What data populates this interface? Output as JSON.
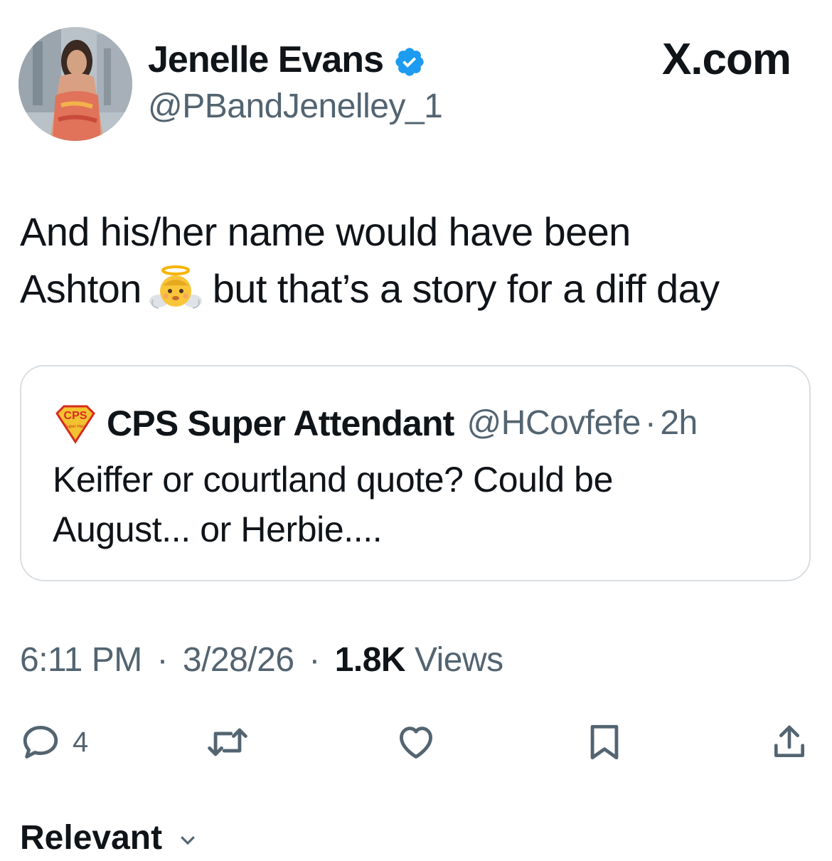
{
  "author": {
    "display_name": "Jenelle Evans",
    "handle": "@PBandJenelley_1",
    "verified_icon": "verified-badge-icon",
    "avatar": "profile-photo"
  },
  "site_mark": "X.com",
  "tweet": {
    "line1": "And his/her name would have been",
    "line2_before": "Ashton",
    "line2_emoji": "baby-angel-emoji",
    "line2_after": "but that’s a story for a diff day"
  },
  "quoted_tweet": {
    "avatar_text": "CPS",
    "avatar_subtext": "Super Hero",
    "display_name": "CPS Super Attendant",
    "handle": "@HCovfefe",
    "separator": "·",
    "time": "2h",
    "line1": "Keiffer or courtland quote? Could be",
    "line2": "August... or Herbie...."
  },
  "meta": {
    "time": "6:11 PM",
    "separator": "·",
    "date": "3/28/26",
    "views_count": "1.8K",
    "views_label": "Views"
  },
  "actions": {
    "reply_count": "4",
    "reply_icon": "reply-icon",
    "repost_icon": "repost-icon",
    "like_icon": "like-icon",
    "bookmark_icon": "bookmark-icon",
    "share_icon": "share-icon"
  },
  "footer": {
    "relevant_label": "Relevant"
  },
  "colors": {
    "text": "#0f1419",
    "secondary": "#536471",
    "verified_blue": "#1d9bf0",
    "border": "#d9dee2"
  }
}
